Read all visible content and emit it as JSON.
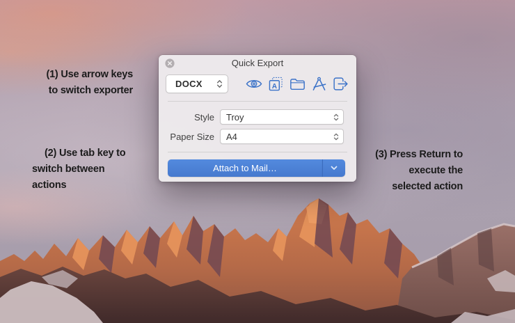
{
  "window": {
    "title": "Quick Export",
    "exporter": {
      "value": "DOCX"
    },
    "toolbar": {
      "icons": [
        "eye-icon",
        "boxed-a-icon",
        "folder-icon",
        "drafting-a-icon",
        "export-arrow-icon"
      ]
    },
    "fields": [
      {
        "label": "Style",
        "value": "Troy"
      },
      {
        "label": "Paper Size",
        "value": "A4"
      }
    ],
    "action_button": {
      "label": "Attach to Mail…"
    }
  },
  "annotations": {
    "note1": {
      "line1": "(1) Use arrow keys",
      "line2": "to switch exporter"
    },
    "note2": {
      "line1": "(2) Use tab key to",
      "line2": "switch between",
      "line3": "actions"
    },
    "note3": {
      "line1": "(3) Press Return to",
      "line2": "execute the",
      "line3": "selected action"
    }
  },
  "colors": {
    "accent_blue": "#3b72c8",
    "button_blue": "#4a7fd5",
    "dialog_bg": "#edeaec",
    "annotation_text": "#1b1b1b"
  }
}
